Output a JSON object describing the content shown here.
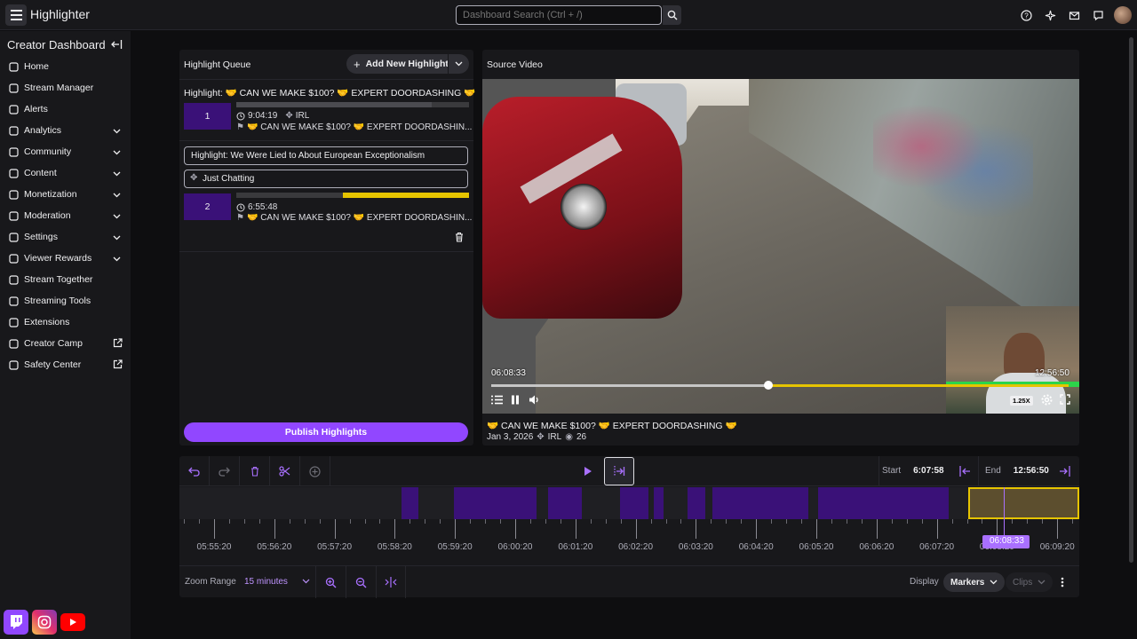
{
  "app": {
    "title": "Highlighter"
  },
  "search": {
    "placeholder": "Dashboard Search (Ctrl + /)"
  },
  "sidebar": {
    "header": "Creator Dashboard",
    "items": [
      {
        "label": "Home",
        "icon": "home-icon",
        "chevron": false,
        "external": false
      },
      {
        "label": "Stream Manager",
        "icon": "stream-manager-icon",
        "chevron": false,
        "external": false
      },
      {
        "label": "Alerts",
        "icon": "alerts-icon",
        "chevron": false,
        "external": false
      },
      {
        "label": "Analytics",
        "icon": "analytics-icon",
        "chevron": true,
        "external": false
      },
      {
        "label": "Community",
        "icon": "community-icon",
        "chevron": true,
        "external": false
      },
      {
        "label": "Content",
        "icon": "content-icon",
        "chevron": true,
        "external": false
      },
      {
        "label": "Monetization",
        "icon": "monetization-icon",
        "chevron": true,
        "external": false
      },
      {
        "label": "Moderation",
        "icon": "moderation-icon",
        "chevron": true,
        "external": false
      },
      {
        "label": "Settings",
        "icon": "settings-icon",
        "chevron": true,
        "external": false
      },
      {
        "label": "Viewer Rewards",
        "icon": "viewer-rewards-icon",
        "chevron": true,
        "external": false
      },
      {
        "label": "Stream Together",
        "icon": "stream-together-icon",
        "chevron": false,
        "external": false
      },
      {
        "label": "Streaming Tools",
        "icon": "streaming-tools-icon",
        "chevron": false,
        "external": false
      },
      {
        "label": "Extensions",
        "icon": "extensions-icon",
        "chevron": false,
        "external": false
      },
      {
        "label": "Creator Camp",
        "icon": "creator-camp-icon",
        "chevron": false,
        "external": true
      },
      {
        "label": "Safety Center",
        "icon": "safety-center-icon",
        "chevron": false,
        "external": true
      }
    ]
  },
  "queue": {
    "title": "Highlight Queue",
    "add_label": "Add New Highlight",
    "publish_label": "Publish Highlights",
    "items": [
      {
        "title": "Highlight: 🤝 CAN WE MAKE $100? 🤝 EXPERT DOORDASHING 🤝",
        "number": "1",
        "duration": "9:04:19",
        "category": "IRL",
        "stream_title": "🤝 CAN WE MAKE $100? 🤝 EXPERT DOORDASHIN..."
      },
      {
        "title": "Highlight: We Were Lied to About European Exceptionalism",
        "category": "Just Chatting",
        "number": "2",
        "duration": "6:55:48",
        "stream_title": "🤝 CAN WE MAKE $100? 🤝 EXPERT DOORDASHIN..."
      }
    ]
  },
  "video": {
    "header": "Source Video",
    "current_time": "06:08:33",
    "end_time": "12:56:50",
    "speed": "1.25X",
    "progress": 0.48,
    "title": "🤝 CAN WE MAKE $100? 🤝 EXPERT DOORDASHING 🤝",
    "date": "Jan 3, 2026",
    "category": "IRL",
    "views": "26"
  },
  "timeline": {
    "start_label": "Start",
    "start_value": "6:07:58",
    "end_label": "End",
    "end_value": "12:56:50",
    "playhead_time": "06:08:33",
    "tick_labels": [
      "05:55:20",
      "05:56:20",
      "05:57:20",
      "05:58:20",
      "05:59:20",
      "06:00:20",
      "06:01:20",
      "06:02:20",
      "06:03:20",
      "06:04:20",
      "06:05:20",
      "06:06:20",
      "06:07:20",
      "06:08:20",
      "06:09:20"
    ],
    "zoom_label": "Zoom Range",
    "zoom_value": "15 minutes",
    "display_label": "Display",
    "markers_label": "Markers",
    "clips_label": "Clips"
  },
  "colors": {
    "accent": "#9147ff",
    "highlight": "#e6c400",
    "segment": "#3a1178",
    "background": "#0e0e10",
    "panel": "#18181b"
  }
}
